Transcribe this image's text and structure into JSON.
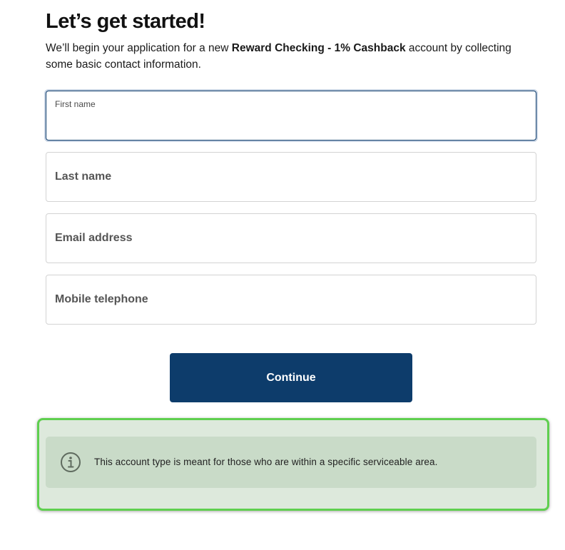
{
  "header": {
    "title": "Let’s get started!",
    "intro_prefix": "We’ll begin your application for a new ",
    "product_name": "Reward Checking - 1% Cashback",
    "intro_suffix": " account by collecting some basic contact information."
  },
  "form": {
    "first_name": {
      "label": "First name",
      "value": "",
      "focused": true
    },
    "last_name": {
      "placeholder": "Last name",
      "value": ""
    },
    "email": {
      "placeholder": "Email address",
      "value": ""
    },
    "mobile": {
      "placeholder": "Mobile telephone",
      "value": ""
    }
  },
  "actions": {
    "continue_label": "Continue"
  },
  "notice": {
    "icon": "info-icon",
    "text": "This account type is meant for those who are within a specific serviceable area."
  },
  "colors": {
    "primary": "#0d3c6b",
    "notice_bg": "#c9dbc8",
    "highlight_border": "#5fcf4f"
  }
}
